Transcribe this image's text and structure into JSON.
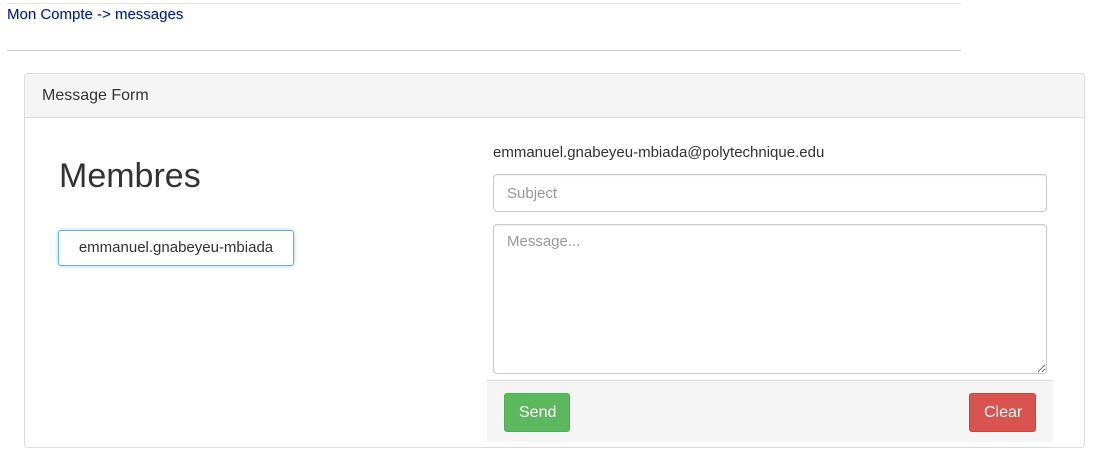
{
  "breadcrumb": {
    "text": "Mon Compte -> messages"
  },
  "panel": {
    "heading": "Message Form"
  },
  "members": {
    "title": "Membres",
    "items": [
      "emmanuel.gnabeyeu-mbiada"
    ]
  },
  "form": {
    "recipient": "emmanuel.gnabeyeu-mbiada@polytechnique.edu",
    "subject_placeholder": "Subject",
    "subject_value": "",
    "message_placeholder": "Message...",
    "message_value": "",
    "send_label": "Send",
    "clear_label": "Clear"
  },
  "colors": {
    "link": "#1a0dab",
    "send": "#5cb85c",
    "clear": "#d9534f",
    "focus_border": "#66afe9"
  }
}
